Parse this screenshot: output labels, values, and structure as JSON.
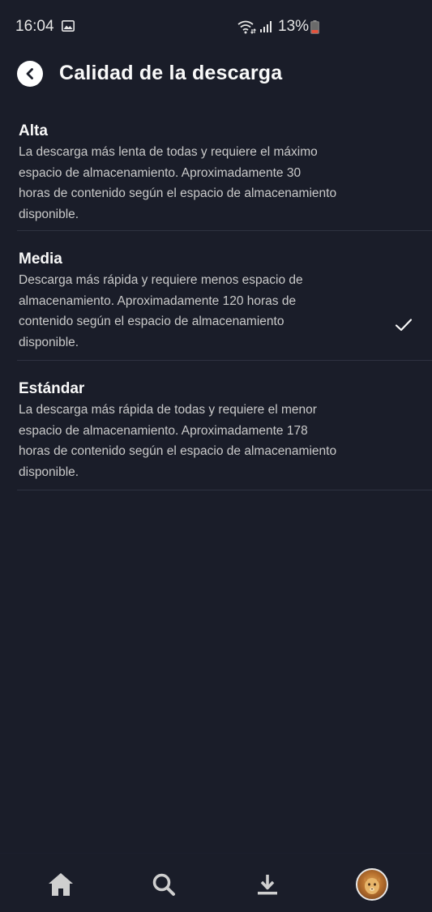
{
  "status_bar": {
    "time": "16:04",
    "battery_percent": "13%",
    "battery_color": "#e5533d",
    "icons": [
      "gallery-icon",
      "wifi-icon",
      "signal-icon",
      "battery-icon"
    ]
  },
  "header": {
    "back_icon": "chevron-left-icon",
    "title": "Calidad de la descarga"
  },
  "options": [
    {
      "title": "Alta",
      "description": "La descarga más lenta de todas y requiere el máximo\nespacio de almacenamiento. Aproximadamente 30\nhoras de contenido según el espacio de almacenamiento\ndisponible.",
      "selected": false
    },
    {
      "title": "Media",
      "description": "Descarga más rápida y requiere menos espacio de\nalmacenamiento. Aproximadamente 120 horas de\ncontenido según el espacio de almacenamiento\ndisponible.",
      "selected": false
    },
    {
      "title": "Estándar",
      "description": "La descarga más rápida de todas y requiere el menor\nespacio de almacenamiento. Aproximadamente 178\nhoras de contenido según el espacio de almacenamiento\ndisponible.",
      "selected": true
    }
  ],
  "bottom_nav": {
    "items": [
      "home-icon",
      "search-icon",
      "download-icon",
      "profile-avatar"
    ]
  },
  "colors": {
    "background": "#1a1d29",
    "divider": "#2e3240",
    "text_primary": "#f9f9f9",
    "text_secondary": "#cacaca",
    "nav_icon": "#cfcfcf"
  }
}
